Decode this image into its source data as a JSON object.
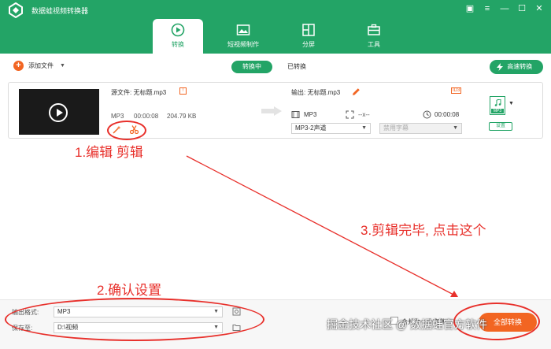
{
  "app": {
    "title": "数据蛙视频转换器",
    "accent": "#23a466",
    "highlight": "#f26522",
    "annotation_color": "#e8302b"
  },
  "window_controls": [
    {
      "name": "feedback-icon"
    },
    {
      "name": "menu-icon"
    },
    {
      "name": "minimize-icon"
    },
    {
      "name": "maximize-icon"
    },
    {
      "name": "close-icon"
    }
  ],
  "tabs": [
    {
      "label": "转换",
      "icon": "convert-icon",
      "active": true
    },
    {
      "label": "短视频制作",
      "icon": "image-icon",
      "active": false
    },
    {
      "label": "分屏",
      "icon": "split-screen-icon",
      "active": false
    },
    {
      "label": "工具",
      "icon": "toolbox-icon",
      "active": false
    }
  ],
  "toolbar": {
    "add_file": "添加文件",
    "converting": "转换中",
    "converted": "已转换",
    "fast_convert": "高速转换"
  },
  "file": {
    "source_label": "源文件: 无标题.mp3",
    "format": "MP3",
    "duration": "00:00:08",
    "size": "204.79 KB",
    "output_label": "输出: 无标题.mp3",
    "out_format": "MP3",
    "resolution": "--x--",
    "out_duration": "00:00:08",
    "channel": "MP3-2声道",
    "subtitle": "禁用字幕",
    "id3": "ID3",
    "file_badge": "MP3",
    "settings": "设置"
  },
  "annotations": {
    "step1": "1.编辑  剪辑",
    "step2": "2.确认设置",
    "step3": "3.剪辑完毕, 点击这个"
  },
  "bottom": {
    "output_format_label": "输出格式:",
    "output_format_value": "MP3",
    "save_to_label": "保存至:",
    "save_to_value": "D:\\视频",
    "merge_label": "合并为一个文件",
    "convert_all": "全部转换",
    "watermark": "掘金技术社区 @ 数据蛙官方软件"
  }
}
